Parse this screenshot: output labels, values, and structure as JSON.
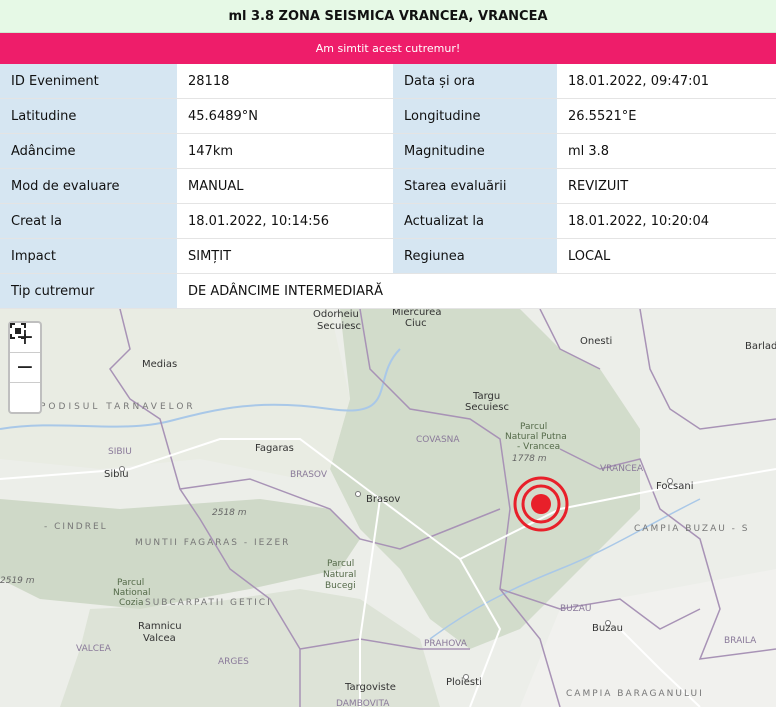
{
  "header": {
    "title": "ml 3.8 ZONA SEISMICA VRANCEA, VRANCEA"
  },
  "felt_button": {
    "label": "Am simtit acest cutremur!"
  },
  "details": {
    "id_label": "ID Eveniment",
    "id_value": "28118",
    "datetime_label": "Data și ora",
    "datetime_value": "18.01.2022, 09:47:01",
    "lat_label": "Latitudine",
    "lat_value": "45.6489°N",
    "lon_label": "Longitudine",
    "lon_value": "26.5521°E",
    "depth_label": "Adâncime",
    "depth_value": "147km",
    "mag_label": "Magnitudine",
    "mag_value": "ml 3.8",
    "eval_mode_label": "Mod de evaluare",
    "eval_mode_value": "MANUAL",
    "eval_status_label": "Starea evaluării",
    "eval_status_value": "REVIZUIT",
    "created_label": "Creat la",
    "created_value": "18.01.2022, 10:14:56",
    "updated_label": "Actualizat la",
    "updated_value": "18.01.2022, 10:20:04",
    "impact_label": "Impact",
    "impact_value": "SIMȚIT",
    "region_label": "Regiunea",
    "region_value": "LOCAL",
    "type_label": "Tip cutremur",
    "type_value": "DE ADÂNCIME INTERMEDIARĂ"
  },
  "map": {
    "zoom_in": "+",
    "zoom_out": "−",
    "fullscreen_icon": "fullscreen-icon",
    "marker_color": "#e8202a",
    "places": {
      "odorheiu": "Odorheiu",
      "secuiesc1": "Secuiesc",
      "miercurea": "Miercurea",
      "ciuc": "Ciuc",
      "onesti": "Onesti",
      "barlad": "Barlad",
      "medias": "Medias",
      "targu": "Targu",
      "secuiesc2": "Secuiesc",
      "podisul": "PODISUL TARNAVELOR",
      "parcul1": "Parcul",
      "natural_putna": "Natural Putna",
      "vrancea_park": "- Vrancea",
      "covasna": "COVASNA",
      "sibiu_county": "SIBIU",
      "sibiu": "Sibiu",
      "fagaras": "Fagaras",
      "brasov_county": "BRASOV",
      "brasov": "Brasov",
      "vrancea_county": "VRANCEA",
      "focsani": "Focsani",
      "elev_1778": "1778 m",
      "elev_2518": "2518 m",
      "elev_2519": "2519 m",
      "cindrel": "- CINDREL",
      "fagaras_mts": "MUNTII FAGARAS - IEZER",
      "campia_buzau": "CAMPIA BUZAU - S",
      "parcul2": "Parcul",
      "natural2": "Natural",
      "bucegi": "Bucegi",
      "parcul3": "Parcul",
      "national": "National",
      "cozia": "Cozia",
      "subcarpatii": "SUBCARPATII GETICI",
      "buzau_county": "BUZAU",
      "buzau": "Buzau",
      "ramnicu": "Ramnicu",
      "valcea": "Valcea",
      "valcea_county": "VALCEA",
      "arges": "ARGES",
      "prahova": "PRAHOVA",
      "braila": "BRAILA",
      "ploiesti": "Ploiesti",
      "targoviste": "Targoviste",
      "dambovita": "DAMBOVITA",
      "campia_baraganului": "CAMPIA BARAGANULUI"
    }
  }
}
